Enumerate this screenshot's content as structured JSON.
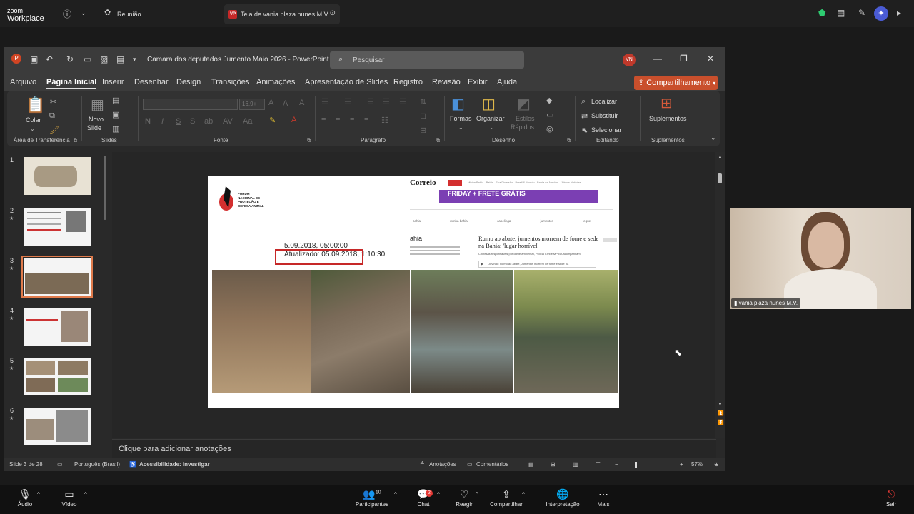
{
  "zoom": {
    "logo_line1": "zoom",
    "logo_line2": "Workplace",
    "meeting_label": "Reunião",
    "share_tab_badge": "VP",
    "share_tab_title": "Tela de vania plaza nunes M.V.",
    "shield_color": "#2ecc71"
  },
  "ppt": {
    "doc_title": "Camara dos deputados Jumento Maio 2026  -  PowerPoint",
    "search_placeholder": "Pesquisar",
    "user_initials": "VN",
    "menu": [
      "Arquivo",
      "Página Inicial",
      "Inserir",
      "Desenhar",
      "Design",
      "Transições",
      "Animações",
      "Apresentação de Slides",
      "Registro",
      "Revisão",
      "Exibir",
      "Ajuda"
    ],
    "share_label": "Compartilhamento",
    "accent": "#c94f2c",
    "ribbon": {
      "colar": "Colar",
      "novo": "Novo",
      "slide": "Slide",
      "font_size": "16,9+",
      "formas": "Formas",
      "organizar": "Organizar",
      "estilos": "Estilos",
      "rapidos": "Rápidos",
      "localizar": "Localizar",
      "substituir": "Substituir",
      "selecionar": "Selecionar",
      "suplementos": "Suplementos",
      "groups": {
        "area": "Área de Transferência",
        "slides": "Slides",
        "fonte": "Fonte",
        "paragrafo": "Parágrafo",
        "desenho": "Desenho",
        "editando": "Editando",
        "suplementos": "Suplementos"
      }
    },
    "thumbs": [
      "1",
      "2",
      "3",
      "4",
      "5",
      "6"
    ],
    "slide": {
      "org_lines": [
        "FORUM",
        "NACIONAL DE",
        "PROTEÇÃO E",
        "DEFESA ANIMAL"
      ],
      "brand": "Correio",
      "banner": "FRIDAY  + FRETE GRÁTIS",
      "nav": [
        "Minha Bahia",
        "Bahia",
        "Sua Diversão",
        "Brasil & Mundo",
        "Bahia na Nación",
        "Últimas Notícias"
      ],
      "subnav": [
        "bahia",
        "minha bahia",
        "capelinga",
        "jumentos",
        "jeque"
      ],
      "section": "ahia",
      "date1": "5.09.2018, 05:00:00",
      "date2": "Atualizado: 05.09.2018,  1:10:30",
      "headline": "Rumo ao abate, jumentos morrem de fome e sede na Bahia: 'lugar horrível'",
      "sub": "Chinesas responsáveis por crime ambiental, Polícia Civil e MP-BA acompanham",
      "audio": "Ouvindo: Rumo ao abate, Jumentos morrem de fome e sede na"
    },
    "notes": "Clique para adicionar anotações",
    "status": {
      "slide": "Slide 3 de 28",
      "lang": "Português (Brasil)",
      "access": "Acessibilidade: investigar",
      "notes": "Anotações",
      "comments": "Comentários",
      "zoom": "57%"
    }
  },
  "webcam": {
    "name": "vania plaza nunes M.V."
  },
  "toolbar": {
    "audio": "Áudio",
    "video": "Vídeo",
    "participants": "Participantes",
    "participants_count": "10",
    "chat": "Chat",
    "chat_badge": "2",
    "react": "Reagir",
    "share": "Compartilhar",
    "interp": "Interpretação",
    "more": "Mais",
    "leave": "Sair"
  }
}
